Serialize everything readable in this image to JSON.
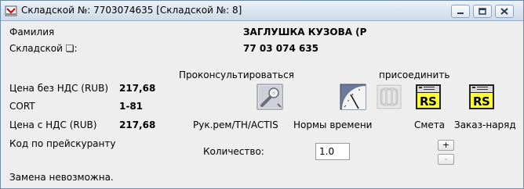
{
  "window": {
    "title": "Складской №: 7703074635 [Складской №: 8]"
  },
  "fields": {
    "surname_label": "Фамилия",
    "surname_value": "ЗАГЛУШКА КУЗОВА (Р",
    "stock_label": "Складской ❏:",
    "stock_value": "77 03 074 635",
    "price_net_label": "Цена без НДС (RUB)",
    "price_net_value": "217,68",
    "cort_label": "CORT",
    "cort_value": "1-81",
    "price_gross_label": "Цена с НДС (RUB)",
    "price_gross_value": "217,68",
    "price_code_label": "Код по прейскуранту"
  },
  "actions": {
    "consult_label": "Проконсультироваться",
    "join_label": "присоединить",
    "manual_label": "Рук.рем/TH/ACTIS",
    "time_norms_label": "Нормы времени",
    "estimate_label": "Смета",
    "order_label": "Заказ-наряд"
  },
  "quantity": {
    "label": "Количество:",
    "value": "1.0",
    "plus": "+",
    "minus": "-"
  },
  "status": "Замена невозможна.",
  "icons": {
    "app": "app-icon",
    "manual": "wrench-manual-icon",
    "time_norms": "clock-icon",
    "join": "link-icon",
    "estimate": "estimate-icon",
    "order": "order-icon"
  },
  "colors": {
    "titlebar": "#dde6f0",
    "background": "#eeeeee",
    "icon_yellow": "#ffff33"
  }
}
